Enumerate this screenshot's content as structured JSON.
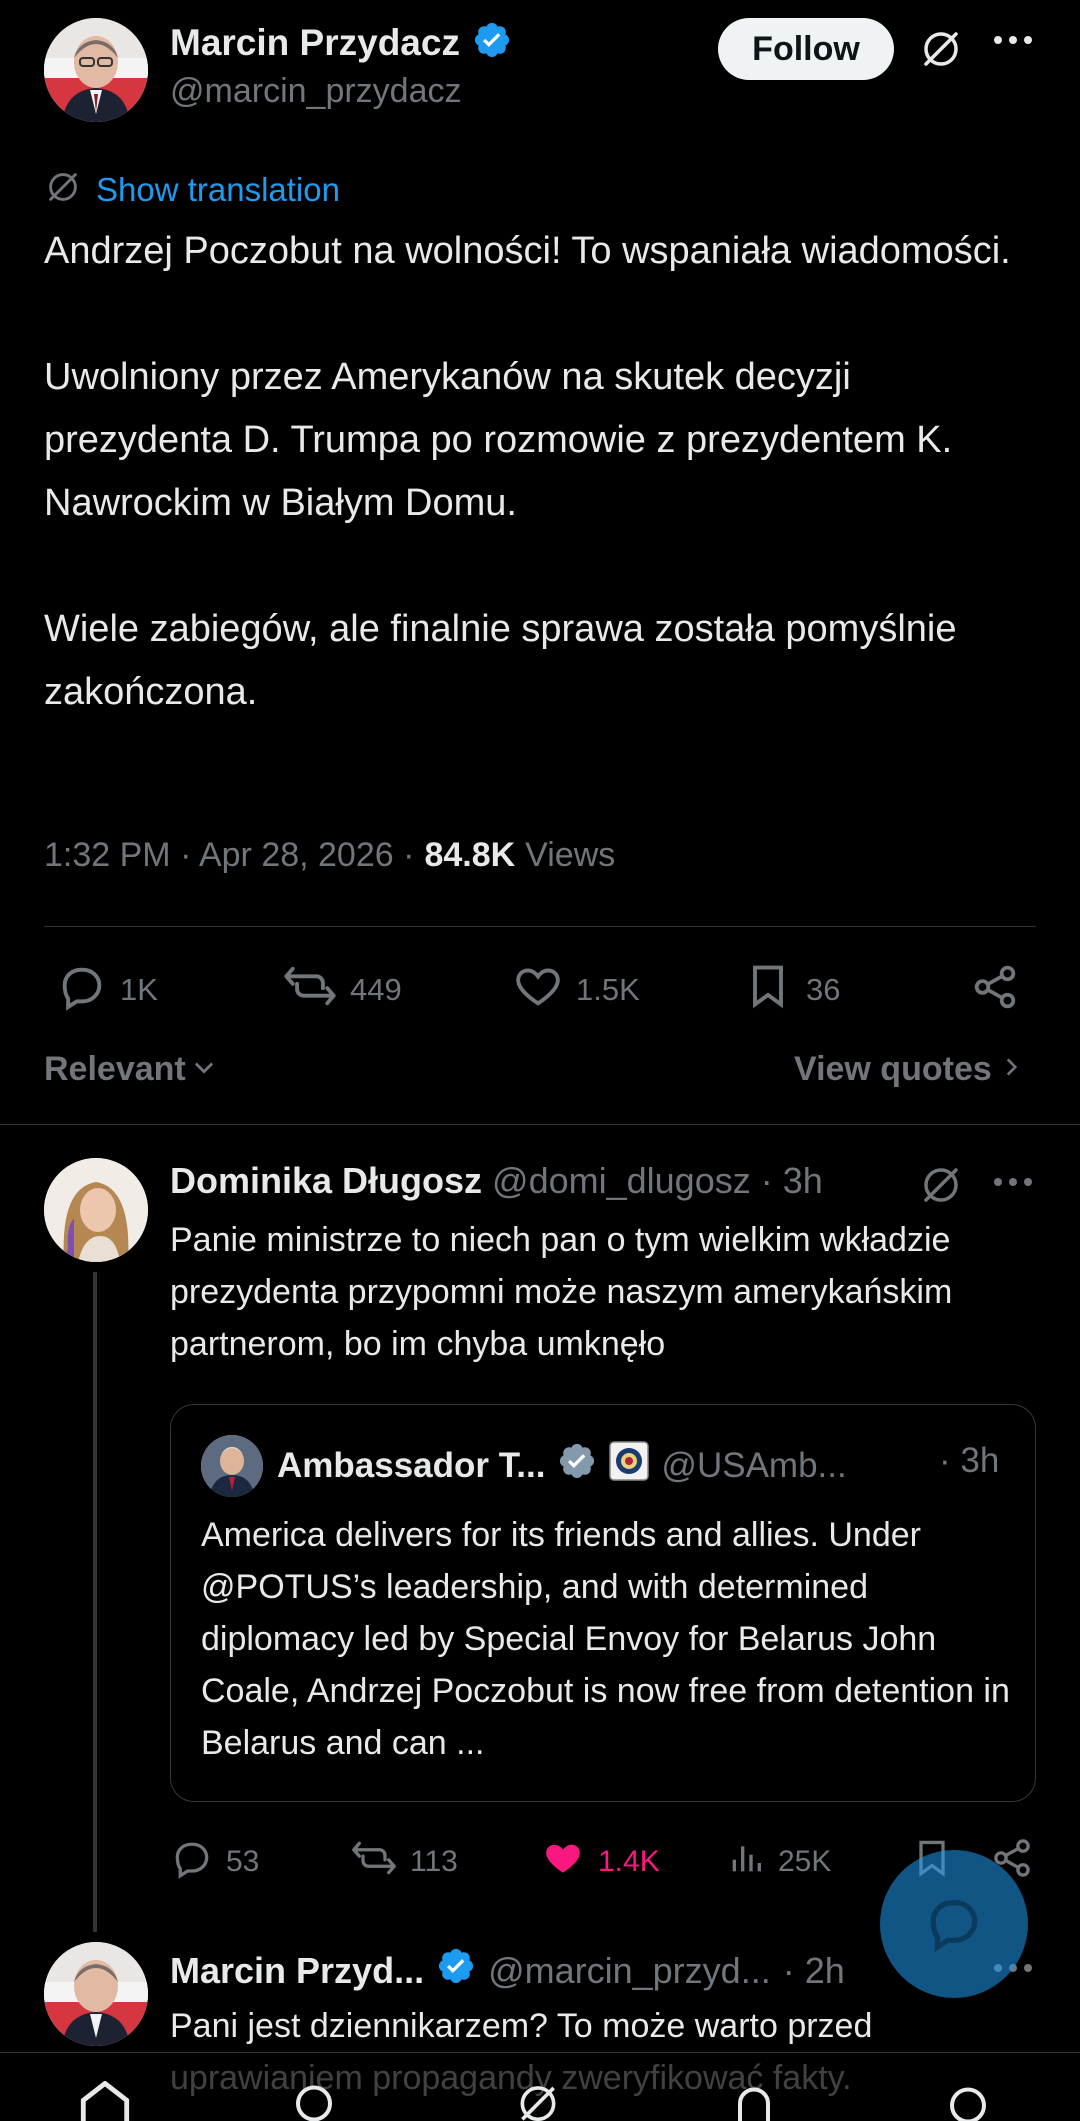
{
  "colors": {
    "background": "#000000",
    "accent": "#1d9bf0",
    "muted": "#71767b",
    "like": "#f91880",
    "verified": "#1d9bf0"
  },
  "main_tweet": {
    "author_name": "Marcin Przydacz",
    "author_handle": "@marcin_przydacz",
    "follow_label": "Follow",
    "show_translation": "Show translation",
    "text_p1": "Andrzej Poczobut na wolności! To wspaniała wiadomości.",
    "text_p2": "Uwolniony przez Amerykanów na skutek decyzji prezydenta D. Trumpa po rozmowie z prezydentem K. Nawrockim w Białym Domu.",
    "text_p3": "Wiele zabiegów, ale finalnie sprawa została pomyślnie zakończona.",
    "timestamp": "1:32 PM · Apr 28, 2026 ·",
    "views_count": "84.8K",
    "views_label": "Views",
    "replies": "1K",
    "reposts": "449",
    "likes": "1.5K",
    "bookmarks": "36"
  },
  "sort": {
    "label": "Relevant",
    "view_quotes": "View quotes"
  },
  "reply1": {
    "author_name": "Dominika Długosz",
    "author_handle": "@domi_dlugosz",
    "time": "· 3h",
    "text": "Panie ministrze to niech pan o tym wielkim wkładzie prezydenta przypomni może naszym amerykańskim partnerom, bo im chyba umknęło",
    "quote": {
      "author_name": "Ambassador T...",
      "author_handle": "@USAmb...",
      "time": "· 3h",
      "text": "America delivers for its friends and allies. Under @POTUS’s leadership, and with determined diplomacy led by Special Envoy for Belarus John Coale, Andrzej Poczobut is now free from detention in Belarus and can ..."
    },
    "replies": "53",
    "reposts": "113",
    "likes": "1.4K",
    "views": "25K"
  },
  "reply2": {
    "author_name": "Marcin Przyd...",
    "author_handle": "@marcin_przyd...",
    "time": "· 2h",
    "text": "Pani jest dziennikarzem? To może warto przed uprawianiem propagandy zweryfikować fakty."
  },
  "icons": [
    "grok-icon",
    "more-icon",
    "reply-icon",
    "repost-icon",
    "like-icon",
    "bookmark-icon",
    "share-icon",
    "views-icon",
    "chevron-down-icon",
    "chevron-right-icon",
    "translate-icon",
    "compose-reply-fab-icon",
    "home-icon",
    "search-icon",
    "grok-tab-icon",
    "notifications-icon",
    "messages-icon"
  ]
}
